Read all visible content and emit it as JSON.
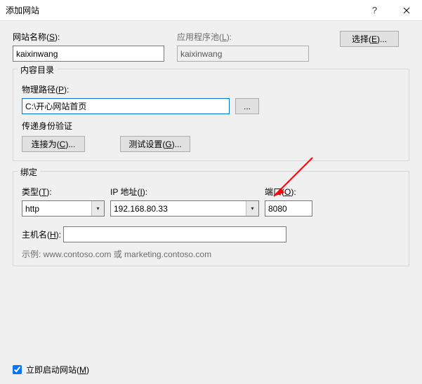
{
  "titlebar": {
    "title": "添加网站"
  },
  "site": {
    "name_label_prefix": "网站名称(",
    "name_label_key": "S",
    "name_label_suffix": "):",
    "name_value": "kaixinwang",
    "pool_label_prefix": "应用程序池(",
    "pool_label_key": "L",
    "pool_label_suffix": "):",
    "pool_value": "kaixinwang",
    "select_btn_prefix": "选择(",
    "select_btn_key": "E",
    "select_btn_suffix": ")..."
  },
  "contentdir": {
    "legend": "内容目录",
    "path_label_prefix": "物理路径(",
    "path_label_key": "P",
    "path_label_suffix": "):",
    "path_value": "C:\\开心网站首页",
    "browse_btn": "...",
    "auth_label": "传递身份验证",
    "connectas_prefix": "连接为(",
    "connectas_key": "C",
    "connectas_suffix": ")...",
    "test_prefix": "测试设置(",
    "test_key": "G",
    "test_suffix": ")..."
  },
  "binding": {
    "legend": "绑定",
    "type_label_prefix": "类型(",
    "type_label_key": "T",
    "type_label_suffix": "):",
    "type_value": "http",
    "ip_label_prefix": "IP 地址(",
    "ip_label_key": "I",
    "ip_label_suffix": "):",
    "ip_value": "192.168.80.33",
    "port_label_prefix": "端口(",
    "port_label_key": "O",
    "port_label_suffix": "):",
    "port_value": "8080",
    "host_label_prefix": "主机名(",
    "host_label_key": "H",
    "host_label_suffix": "):",
    "host_value": "",
    "example": "示例: www.contoso.com 或 marketing.contoso.com"
  },
  "footer": {
    "start_label_prefix": "立即启动网站(",
    "start_label_key": "M",
    "start_label_suffix": ")"
  }
}
